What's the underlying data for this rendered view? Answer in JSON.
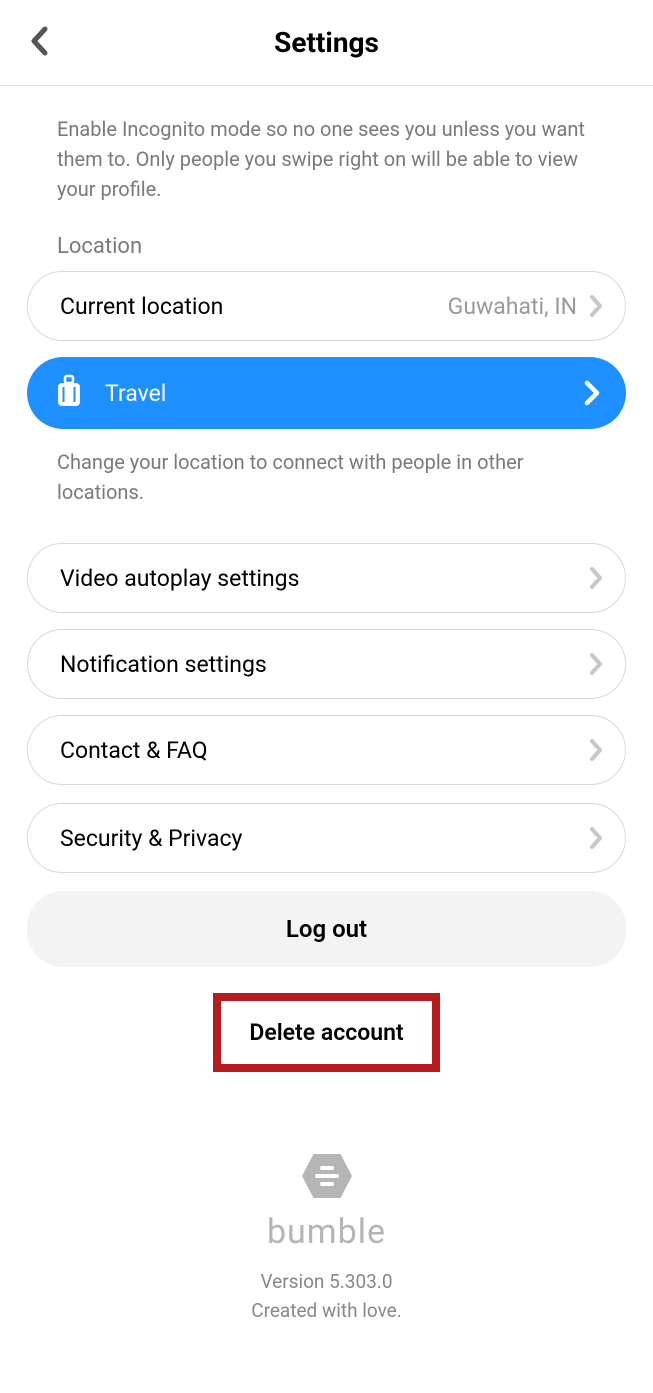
{
  "header": {
    "title": "Settings"
  },
  "incognito": {
    "description": "Enable Incognito mode so no one sees you unless you want them to. Only people you swipe right on will be able to view your profile."
  },
  "location": {
    "section_label": "Location",
    "current_label": "Current location",
    "current_value": "Guwahati, IN"
  },
  "travel": {
    "label": "Travel",
    "description": "Change your location to connect with people in other locations."
  },
  "rows": {
    "video": "Video autoplay settings",
    "notifications": "Notification settings",
    "contact": "Contact & FAQ",
    "security": "Security & Privacy"
  },
  "actions": {
    "logout": "Log out",
    "delete": "Delete account"
  },
  "footer": {
    "brand": "bumble",
    "version": "Version 5.303.0",
    "tagline": "Created with love."
  }
}
